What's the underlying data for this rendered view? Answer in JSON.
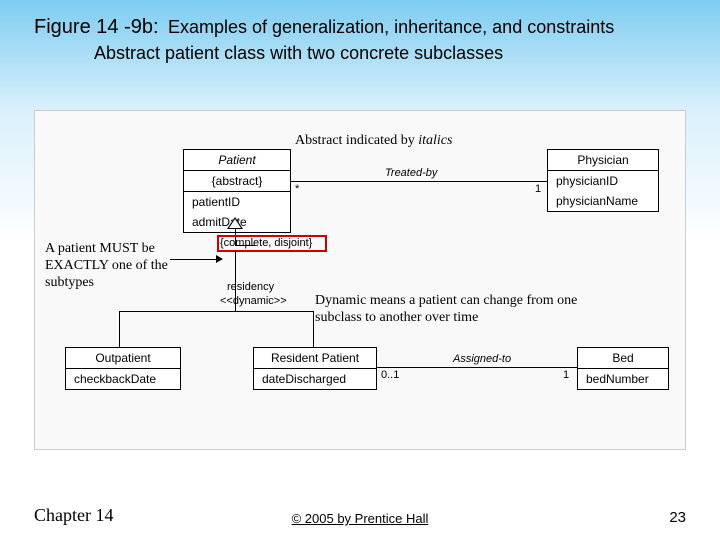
{
  "title": {
    "figure_label": "Figure 14 -9b:",
    "line1": "Examples of generalization, inheritance, and constraints",
    "line2": "Abstract patient class with two concrete subclasses"
  },
  "notes": {
    "abstract_italics": "Abstract indicated by italics",
    "must_be": "A patient MUST be EXACTLY one of the subtypes",
    "dynamic": "Dynamic means a patient can change from one subclass to another over time"
  },
  "uml": {
    "patient": {
      "name": "Patient",
      "stereo": "{abstract}",
      "attrs": [
        "patientID",
        "admitDate"
      ]
    },
    "physician": {
      "name": "Physician",
      "attrs": [
        "physicianID",
        "physicianName"
      ]
    },
    "outpatient": {
      "name": "Outpatient",
      "attrs": [
        "checkbackDate"
      ]
    },
    "resident": {
      "name": "Resident Patient",
      "attrs": [
        "dateDischarged"
      ]
    },
    "bed": {
      "name": "Bed",
      "attrs": [
        "bedNumber"
      ]
    }
  },
  "assoc": {
    "treated_by": {
      "label": "Treated-by",
      "left_mult": "*",
      "right_mult": "1"
    },
    "assigned_to": {
      "label": "Assigned-to",
      "left_mult": "0..1",
      "right_mult": "1"
    },
    "constraint": "{complete, disjoint}",
    "discr": "residency",
    "dyn": "<<dynamic>>"
  },
  "footer": {
    "chapter": "Chapter 14",
    "copyright": "© 2005 by Prentice Hall",
    "page": "23"
  }
}
